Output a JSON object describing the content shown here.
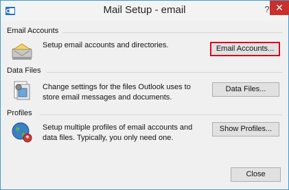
{
  "window": {
    "title": "Mail Setup - email",
    "help_glyph": "?",
    "close_glyph": "✕"
  },
  "sections": {
    "email": {
      "label": "Email Accounts",
      "description": "Setup email accounts and directories.",
      "button": "Email Accounts..."
    },
    "data": {
      "label": "Data Files",
      "description_line1": "Change settings for the files Outlook uses to",
      "description_line2": "store email messages and documents.",
      "button": "Data Files..."
    },
    "profiles": {
      "label": "Profiles",
      "description_line1": "Setup multiple profiles of email accounts and",
      "description_line2": "data files. Typically, you only need one.",
      "button": "Show Profiles..."
    }
  },
  "footer": {
    "close_button": "Close"
  },
  "icons": {
    "title": "outlook-icon",
    "email": "email-accounts-icon",
    "data": "data-files-icon",
    "profiles": "profiles-icon"
  },
  "colors": {
    "window_border": "#3a9bd6",
    "close_red": "#c7302b",
    "highlight_red": "#d10b1c"
  }
}
